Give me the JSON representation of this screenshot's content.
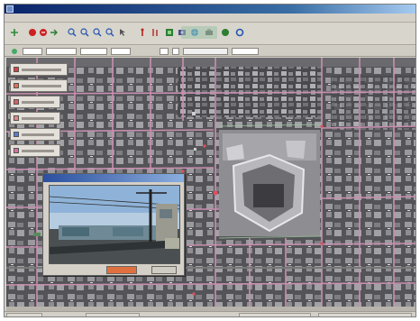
{
  "app": {
    "icon": "app-logo-icon",
    "accent": "#0a246a"
  },
  "menubar": {
    "items": [
      {
        "label": ""
      },
      {
        "label": ""
      },
      {
        "label": ""
      },
      {
        "label": ""
      },
      {
        "label": ""
      },
      {
        "label": ""
      }
    ]
  },
  "toolbar": {
    "tools": [
      {
        "icon": "pan-icon",
        "color": "#2e8b3a"
      },
      {
        "icon": "stop-icon",
        "color": "#cc2222"
      },
      {
        "icon": "stop-alt-icon",
        "color": "#cc2222"
      },
      {
        "icon": "forward-icon",
        "color": "#2e7d32"
      },
      {
        "icon": "zoom-in-icon",
        "color": "#2456b0"
      },
      {
        "icon": "zoom-out-icon",
        "color": "#2456b0"
      },
      {
        "icon": "zoom-extent-icon",
        "color": "#2456b0"
      },
      {
        "icon": "zoom-window-icon",
        "color": "#2456b0"
      },
      {
        "icon": "select-icon",
        "color": "#555555"
      },
      {
        "icon": "identify-icon",
        "color": "#b3261e"
      },
      {
        "icon": "measure-icon",
        "color": "#b3261e"
      },
      {
        "icon": "layers-icon",
        "color": "#2e7d32"
      },
      {
        "icon": "photo-icon",
        "color": "#4a4a8a"
      },
      {
        "icon": "globe-icon",
        "color": "#1e6fb8"
      },
      {
        "icon": "print-icon",
        "color": "#555555"
      },
      {
        "icon": "help-icon",
        "color": "#2e7d32"
      },
      {
        "icon": "settings-icon",
        "color": "#2456b0"
      }
    ]
  },
  "layers_panel": {
    "items": [
      {
        "color": "#d84040"
      },
      {
        "color": "#e07050"
      },
      {
        "color": "#d86060"
      },
      {
        "color": "#e08888"
      },
      {
        "color": "#5a7acc"
      },
      {
        "color": "#d870a0"
      }
    ]
  },
  "photo_viewer": {
    "buttons": [
      {
        "color": "#e07040"
      },
      {
        "color": "#cfccc4"
      }
    ]
  },
  "statusbar": {
    "cells": [
      {
        "value": ""
      },
      {
        "value": ""
      },
      {
        "value": ""
      },
      {
        "value": ""
      }
    ]
  },
  "map": {
    "road_color": "#c890b0",
    "highlight_color": "#e05060"
  }
}
